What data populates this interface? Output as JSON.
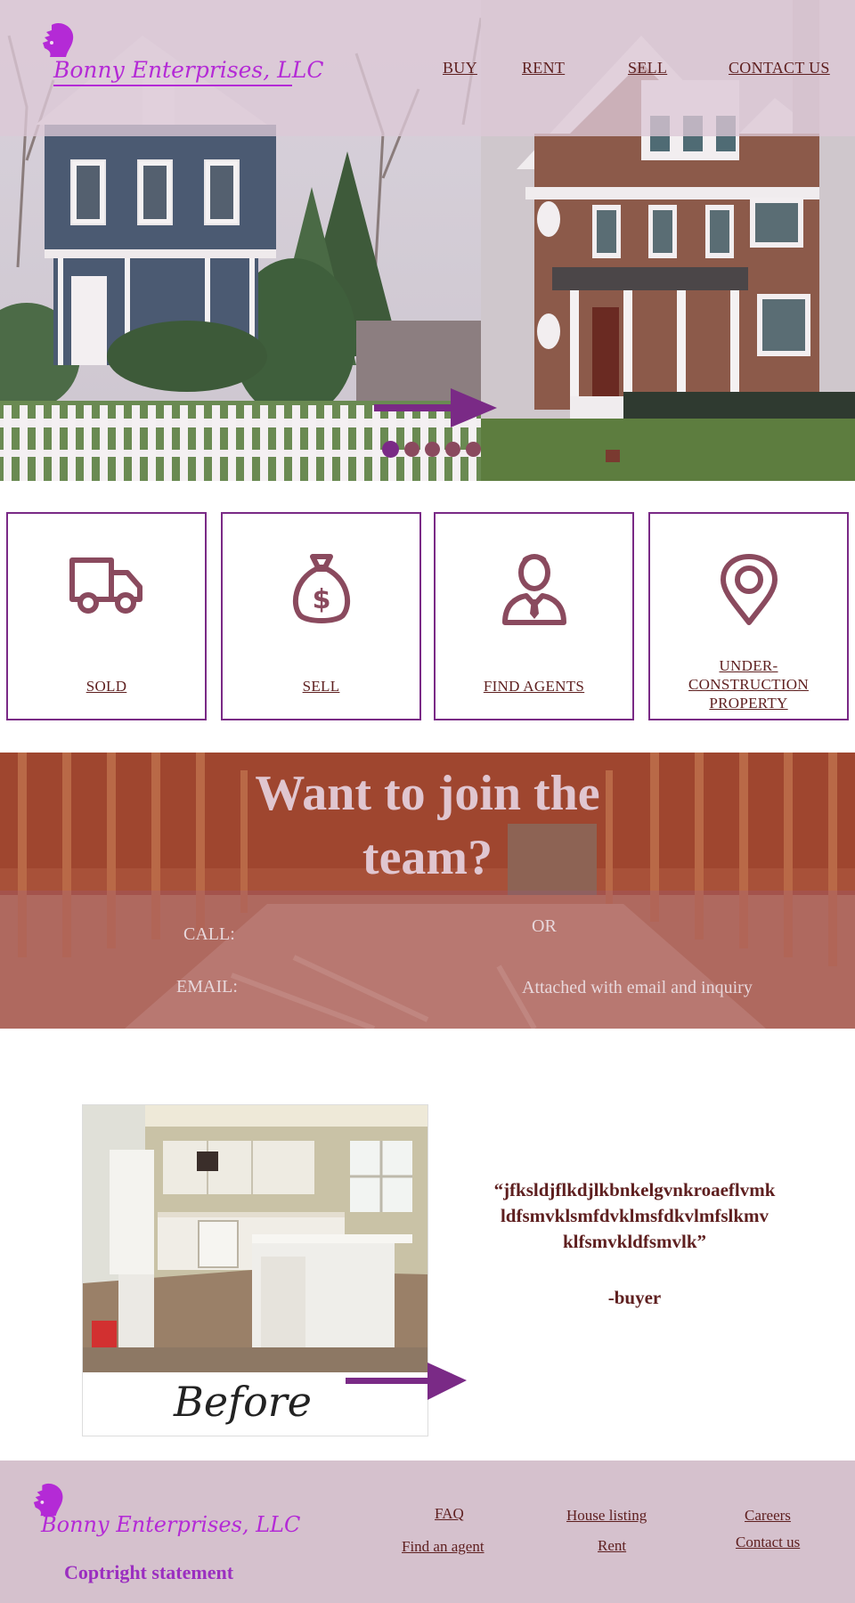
{
  "brand": {
    "name": "Bonny Enterprises, LLC"
  },
  "nav": [
    {
      "label": "BUY"
    },
    {
      "label": "RENT"
    },
    {
      "label": "SELL"
    },
    {
      "label": "CONTACT US"
    }
  ],
  "hero": {
    "slide_count": 5,
    "active_slide": 1
  },
  "services": [
    {
      "label": "SOLD",
      "icon": "truck-icon"
    },
    {
      "label": "SELL",
      "icon": "money-bag-icon"
    },
    {
      "label": "FIND AGENTS",
      "icon": "agent-icon"
    },
    {
      "label_lines": [
        "UNDER-",
        "CONSTRUCTION",
        "PROPERTY"
      ],
      "icon": "location-pin-icon"
    }
  ],
  "join": {
    "title_line1": "Want to join the",
    "title_line2": "team?",
    "call_label": "CALL:",
    "or_label": "OR",
    "email_label": "EMAIL:",
    "attach_text": "Attached with email and inquiry"
  },
  "testimonial": {
    "photo_caption": "Before",
    "quote_lines": [
      "“jfksldjflkdjlkbnkelgvnkroaeflvmk",
      "ldfsmvklsmfdvklmsfdkvlmfslkmv",
      "klfsmvkldfsmvlk”"
    ],
    "author": "-buyer"
  },
  "footer": {
    "brand": "Bonny Enterprises, LLC",
    "copyright": "Coptright statement",
    "links": {
      "faq": "FAQ",
      "find_agent": "Find an agent",
      "house_listing": "House listing",
      "rent": "Rent",
      "careers": "Careers",
      "contact": "Contact us"
    }
  },
  "colors": {
    "accent": "#7a2a86",
    "brand_text": "#b42ad6",
    "link_text": "#5e1f1f",
    "header_band": "#dcc8d6",
    "footer_bg": "#d5c1cd"
  }
}
